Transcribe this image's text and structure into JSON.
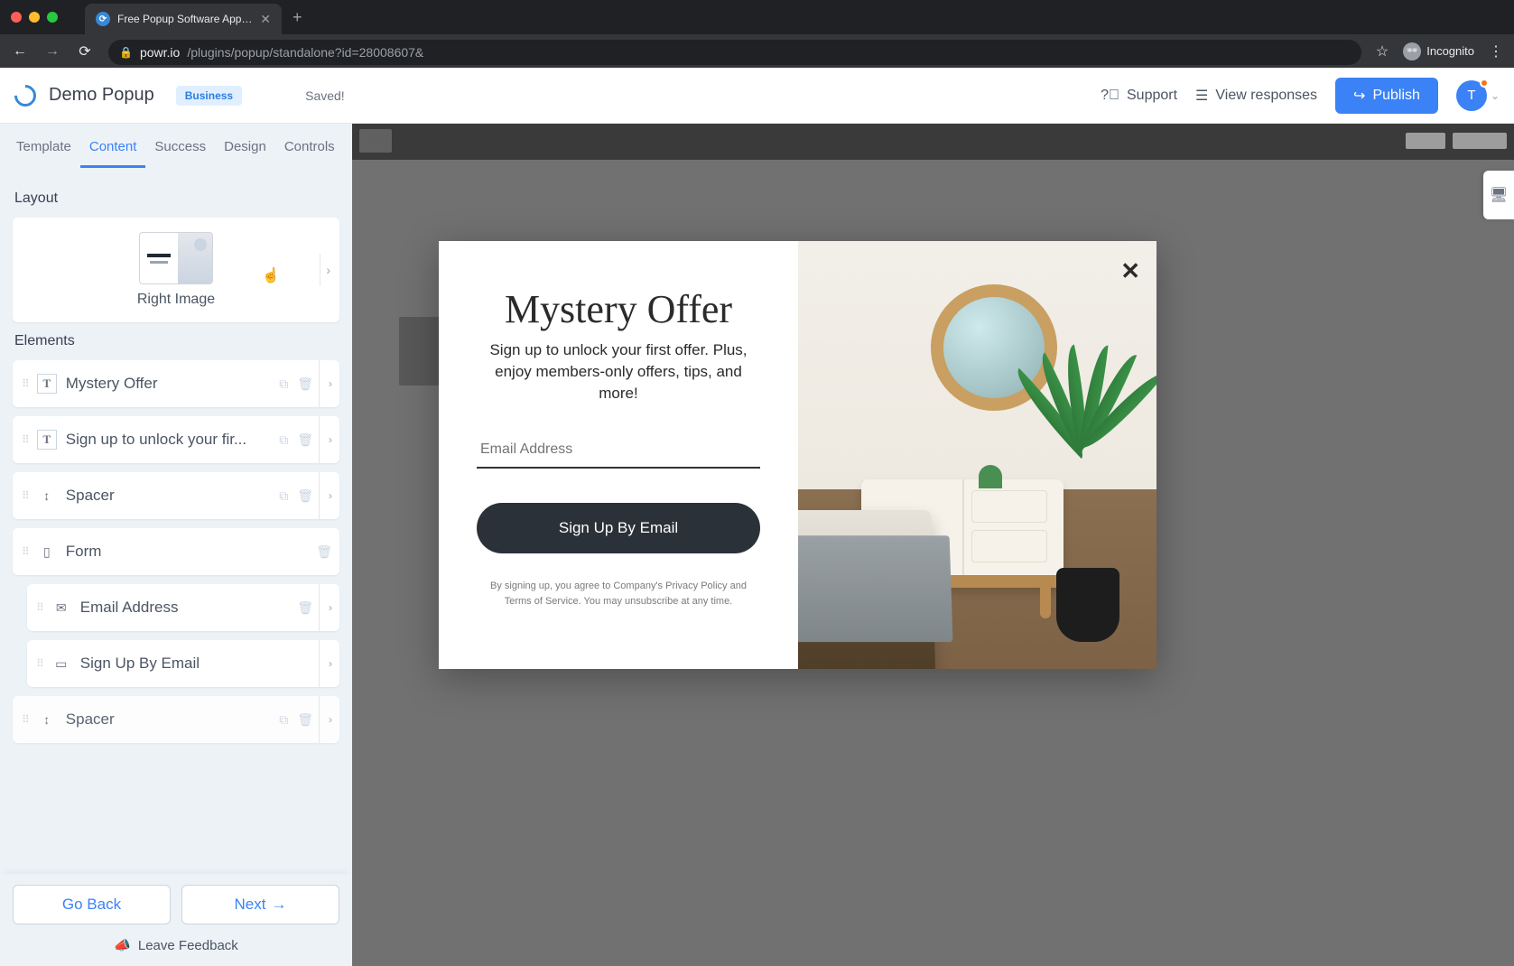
{
  "browser": {
    "tab_title": "Free Popup Software Applicati",
    "url_host": "powr.io",
    "url_path": "/plugins/popup/standalone?id=28008607&",
    "incognito": "Incognito"
  },
  "header": {
    "app_title": "Demo Popup",
    "plan": "Business",
    "saved": "Saved!",
    "support": "Support",
    "view_responses": "View responses",
    "publish": "Publish",
    "avatar_letter": "T"
  },
  "tabs": {
    "template": "Template",
    "content": "Content",
    "success": "Success",
    "design": "Design",
    "controls": "Controls"
  },
  "layout": {
    "section": "Layout",
    "selected": "Right Image"
  },
  "elements": {
    "section": "Elements",
    "items": [
      {
        "type": "text",
        "label": "Mystery Offer"
      },
      {
        "type": "text",
        "label": "Sign up to unlock your fir..."
      },
      {
        "type": "spacer",
        "label": "Spacer"
      },
      {
        "type": "form",
        "label": "Form"
      },
      {
        "type": "email",
        "label": "Email Address",
        "nested": true
      },
      {
        "type": "button",
        "label": "Sign Up By Email",
        "nested": true
      },
      {
        "type": "spacer",
        "label": "Spacer"
      }
    ]
  },
  "footer": {
    "back": "Go Back",
    "next": "Next",
    "feedback": "Leave Feedback"
  },
  "popup": {
    "title": "Mystery Offer",
    "subtitle": "Sign up to unlock your first offer. Plus, enjoy members-only offers, tips, and more!",
    "email_placeholder": "Email Address",
    "cta": "Sign Up By Email",
    "legal": "By signing up, you agree to Company's Privacy Policy and Terms of Service. You may unsubscribe at any time."
  }
}
